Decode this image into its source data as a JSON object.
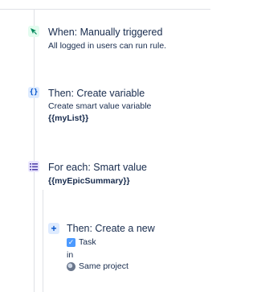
{
  "steps": {
    "trigger": {
      "icon": "cursor-click-icon",
      "title": "When: Manually triggered",
      "subtitle": "All logged in users can run rule."
    },
    "create_variable": {
      "icon": "braces-icon",
      "icon_glyph": "{}",
      "title": "Then: Create variable",
      "subtitle": "Create smart value variable",
      "value": "{{myList}}"
    },
    "for_each": {
      "icon": "list-icon",
      "title": "For each: Smart value",
      "value": "{{myEpicSummary}}"
    },
    "create_new": {
      "icon": "plus-icon",
      "icon_glyph": "+",
      "title": "Then: Create a new",
      "issue_type": "Task",
      "connector": "in",
      "project": "Same project"
    }
  },
  "colors": {
    "text": "#172b4d",
    "divider": "#dfe1e6",
    "trigger_accent": "#00875a",
    "variable_accent": "#0052cc",
    "foreach_accent": "#5243aa",
    "task_checkbox": "#4c9aff"
  }
}
